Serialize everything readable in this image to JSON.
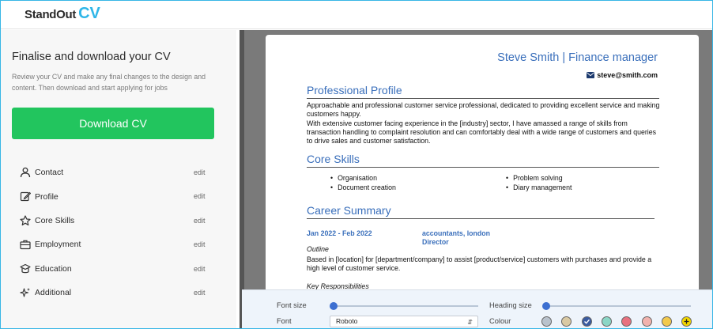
{
  "logo": {
    "part1": "StandOut",
    "part2": "CV"
  },
  "sidebar": {
    "title": "Finalise and download your CV",
    "description": "Review your CV and make any final changes to the design and content. Then download and start applying for jobs",
    "download_label": "Download CV",
    "sections": [
      {
        "label": "Contact",
        "edit": "edit",
        "icon": "person-icon"
      },
      {
        "label": "Profile",
        "edit": "edit",
        "icon": "pencil-icon"
      },
      {
        "label": "Core Skills",
        "edit": "edit",
        "icon": "star-icon"
      },
      {
        "label": "Employment",
        "edit": "edit",
        "icon": "briefcase-icon"
      },
      {
        "label": "Education",
        "edit": "edit",
        "icon": "graduation-cap-icon"
      },
      {
        "label": "Additional",
        "edit": "edit",
        "icon": "sparkles-icon"
      }
    ]
  },
  "cv": {
    "name": "Steve Smith | Finance manager",
    "email": "steve@smith.com",
    "profile_heading": "Professional Profile",
    "profile_p1": "Approachable and professional customer service professional, dedicated to providing excellent service and making customers happy.",
    "profile_p2": "With extensive customer facing experience in the [industry] sector, I have amassed a range of skills from transaction handling to complaint resolution and can comfortably deal with a wide range of customers and queries to drive sales and customer satisfaction.",
    "skills_heading": "Core Skills",
    "skills": [
      "Organisation",
      "Document creation",
      "Problem solving",
      "Diary management"
    ],
    "career_heading": "Career Summary",
    "job_dates": "Jan 2022 - Feb 2022",
    "job_company": "accountants, london",
    "job_title": "Director",
    "outline_label": "Outline",
    "job_desc": "Based in [location] for [department/company] to assist [product/service] customers with purchases and provide a high level of customer service.",
    "key_resp_label": "Key Responsibilities"
  },
  "tools": {
    "font_size_label": "Font size",
    "heading_size_label": "Heading size",
    "font_label": "Font",
    "font_value": "Roboto",
    "colour_label": "Colour",
    "colours": [
      "#b9c2cc",
      "#d9c9a3",
      "#3a5ba0",
      "#8ad6c6",
      "#e8717f",
      "#f2b2ad",
      "#f2c94c",
      "#f2d600"
    ],
    "selected_colour_index": 2
  }
}
